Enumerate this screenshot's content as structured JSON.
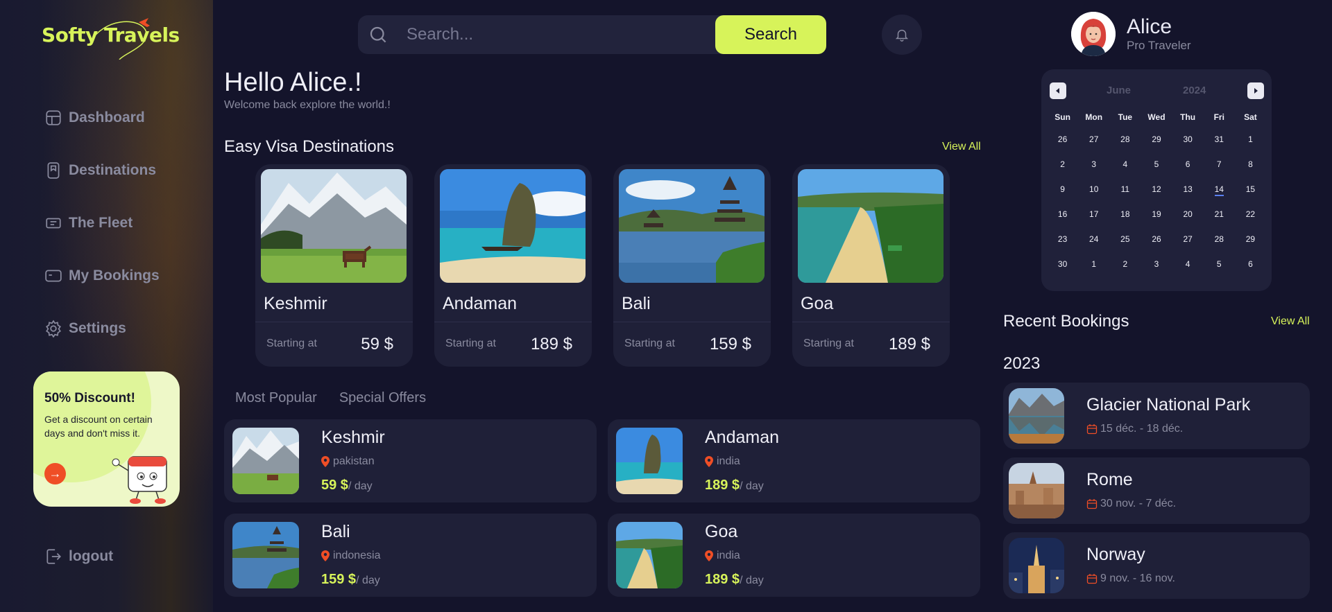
{
  "brand": {
    "name": "Softy Travels",
    "accent": "#d7f35a"
  },
  "sidebar": {
    "items": [
      {
        "label": "Dashboard",
        "icon": "dashboard-icon"
      },
      {
        "label": "Destinations",
        "icon": "bookmark-icon"
      },
      {
        "label": "The Fleet",
        "icon": "ticket-icon"
      },
      {
        "label": "My Bookings",
        "icon": "card-icon"
      },
      {
        "label": "Settings",
        "icon": "gear-icon"
      }
    ],
    "promo": {
      "title": "50% Discount!",
      "text": "Get a discount on certain days and don't miss it.",
      "button_icon": "arrow-right-icon"
    },
    "logout_label": "logout"
  },
  "search": {
    "placeholder": "Search...",
    "button_label": "Search"
  },
  "user": {
    "name": "Alice",
    "role": "Pro Traveler"
  },
  "greeting": {
    "title": "Hello Alice.!",
    "subtitle": "Welcome back explore the world.!"
  },
  "easy_visa": {
    "title": "Easy Visa Destinations",
    "view_all": "View All",
    "cards": [
      {
        "name": "Keshmir",
        "starting_label": "Starting at",
        "price": "59 $"
      },
      {
        "name": "Andaman",
        "starting_label": "Starting at",
        "price": "189 $"
      },
      {
        "name": "Bali",
        "starting_label": "Starting at",
        "price": "159 $"
      },
      {
        "name": "Goa",
        "starting_label": "Starting at",
        "price": "189 $"
      }
    ]
  },
  "tabs": [
    "Most Popular",
    "Special Offers"
  ],
  "offers": [
    {
      "name": "Keshmir",
      "location": "pakistan",
      "price": "59 $",
      "unit": "/ day"
    },
    {
      "name": "Andaman",
      "location": "india",
      "price": "189 $",
      "unit": "/ day"
    },
    {
      "name": "Bali",
      "location": "indonesia",
      "price": "159 $",
      "unit": "/ day"
    },
    {
      "name": "Goa",
      "location": "india",
      "price": "189 $",
      "unit": "/ day"
    }
  ],
  "calendar": {
    "month": "June",
    "year": "2024",
    "weekdays": [
      "Sun",
      "Mon",
      "Tue",
      "Wed",
      "Thu",
      "Fri",
      "Sat"
    ],
    "weeks": [
      [
        "26",
        "27",
        "28",
        "29",
        "30",
        "31",
        "1"
      ],
      [
        "2",
        "3",
        "4",
        "5",
        "6",
        "7",
        "8"
      ],
      [
        "9",
        "10",
        "11",
        "12",
        "13",
        "14",
        "15"
      ],
      [
        "16",
        "17",
        "18",
        "19",
        "20",
        "21",
        "22"
      ],
      [
        "23",
        "24",
        "25",
        "26",
        "27",
        "28",
        "29"
      ],
      [
        "30",
        "1",
        "2",
        "3",
        "4",
        "5",
        "6"
      ]
    ],
    "today": "14"
  },
  "bookings": {
    "title": "Recent Bookings",
    "view_all": "View All",
    "year": "2023",
    "items": [
      {
        "name": "Glacier National Park",
        "dates": "15 déc. - 18 déc."
      },
      {
        "name": "Rome",
        "dates": "30 nov. - 7 déc."
      },
      {
        "name": "Norway",
        "dates": "9 nov. - 16 nov."
      }
    ]
  }
}
